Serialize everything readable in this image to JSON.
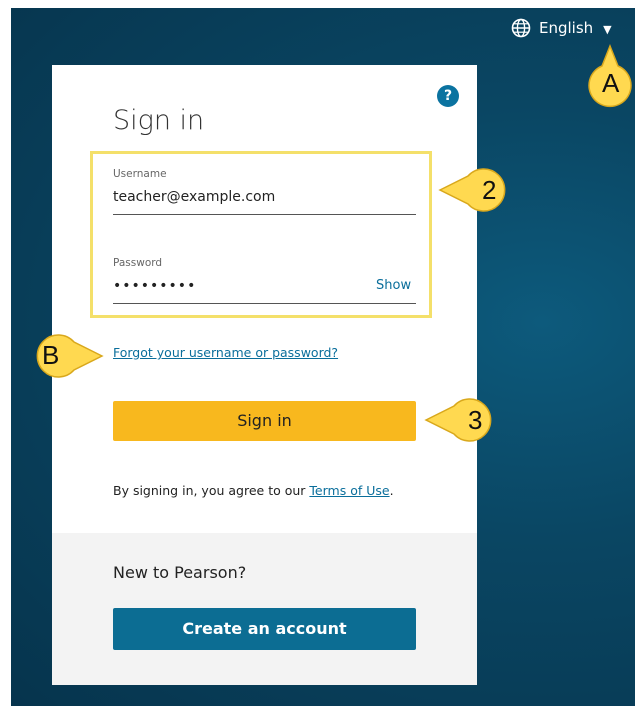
{
  "language": {
    "icon": "globe-icon",
    "label": "English",
    "caret": "▼"
  },
  "card": {
    "title": "Sign in",
    "help_icon": "?",
    "username": {
      "label": "Username",
      "value": "teacher@example.com"
    },
    "password": {
      "label": "Password",
      "value": "•••••••••",
      "toggle": "Show"
    },
    "forgot_link": "Forgot your username or password?",
    "signin_button": "Sign in",
    "terms_prefix": "By signing in, you agree to our ",
    "terms_link": "Terms of Use",
    "terms_suffix": ".",
    "new_to": "New to Pearson?",
    "create_button": "Create an account"
  },
  "callouts": {
    "a": "A",
    "b": "B",
    "two": "2",
    "three": "3"
  },
  "colors": {
    "accent_yellow": "#f8b81e",
    "brand_blue": "#0c6d93",
    "callout_fill": "#ffd950",
    "highlight": "#f4e06a"
  }
}
